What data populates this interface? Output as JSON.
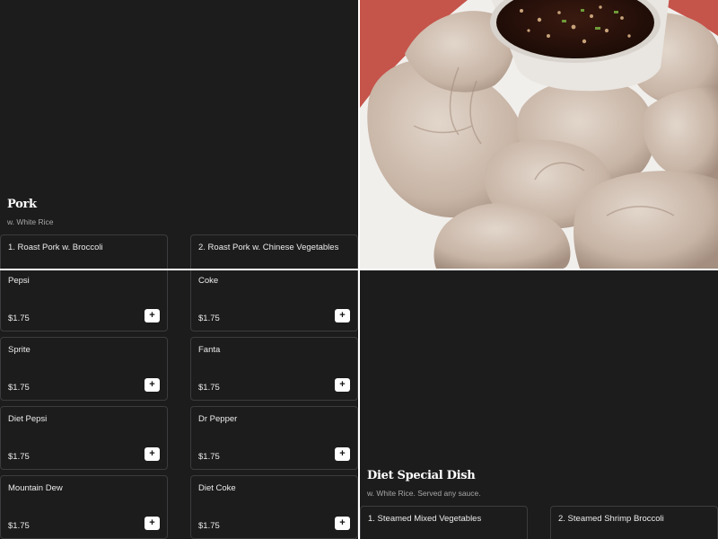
{
  "pork": {
    "title": "Pork",
    "subtitle": "w. White Rice",
    "items": [
      {
        "name": "1. Roast Pork w. Broccoli"
      },
      {
        "name": "2. Roast Pork w. Chinese Vegetables"
      }
    ]
  },
  "drinks": {
    "items": [
      {
        "name": "Pepsi",
        "price": "$1.75"
      },
      {
        "name": "Coke",
        "price": "$1.75"
      },
      {
        "name": "Sprite",
        "price": "$1.75"
      },
      {
        "name": "Fanta",
        "price": "$1.75"
      },
      {
        "name": "Diet Pepsi",
        "price": "$1.75"
      },
      {
        "name": "Dr Pepper",
        "price": "$1.75"
      },
      {
        "name": "Mountain Dew",
        "price": "$1.75"
      },
      {
        "name": "Diet Coke",
        "price": "$1.75"
      }
    ],
    "add_label": "+"
  },
  "diet": {
    "title": "Diet Special Dish",
    "subtitle": "w. White Rice. Served any sauce.",
    "items": [
      {
        "name": "1. Steamed Mixed Vegetables"
      },
      {
        "name": "2. Steamed Shrimp Broccoli"
      }
    ]
  },
  "icons": {
    "add": "plus-icon",
    "photo": "dumplings-photo"
  },
  "colors": {
    "background": "#1c1c1d",
    "card_border": "#3c3c3e",
    "button": "#ffffff",
    "text": "#ececec",
    "muted": "#a7a7a7"
  }
}
